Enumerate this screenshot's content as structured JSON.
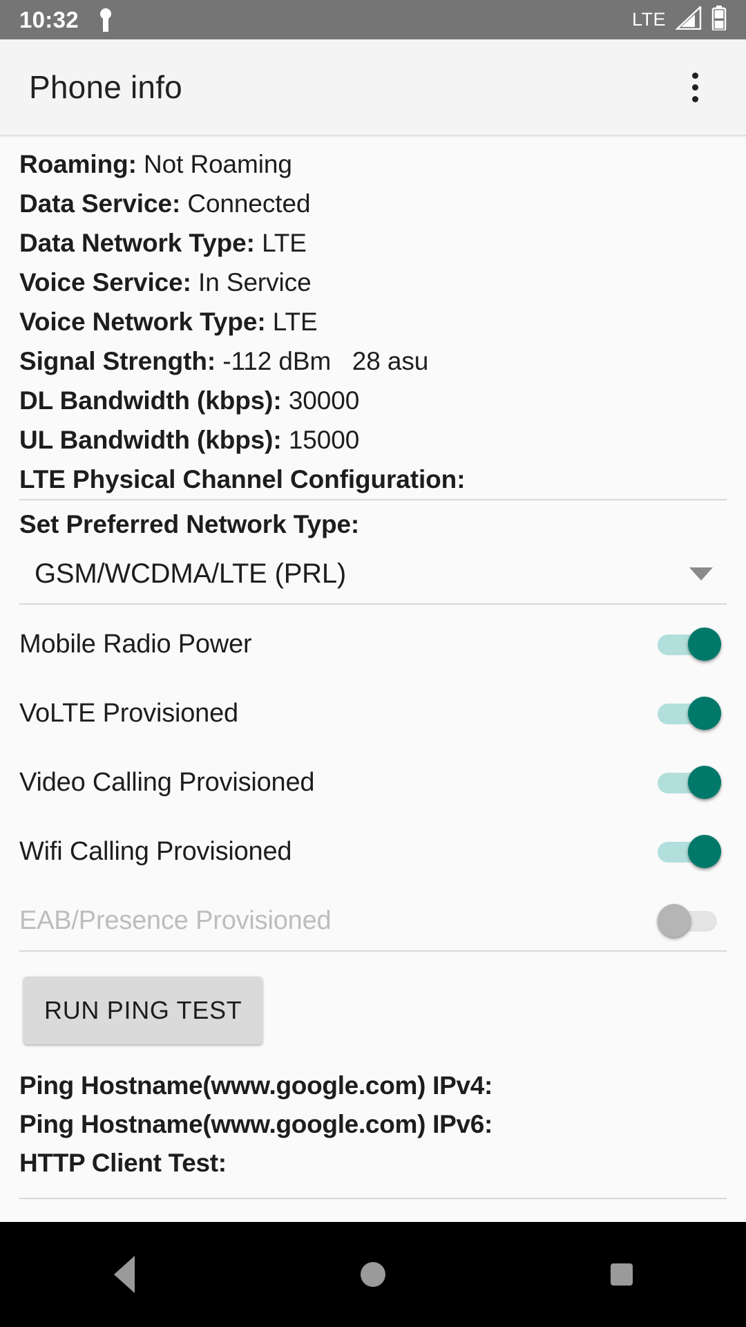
{
  "statusbar": {
    "clock": "10:32",
    "vpn_icon": "vpn-key-icon",
    "network_label": "LTE",
    "signal_icon": "signal-cellular-icon",
    "battery_icon": "battery-icon"
  },
  "appbar": {
    "title": "Phone info",
    "overflow_icon": "overflow-menu-icon"
  },
  "info": [
    {
      "key": "Roaming:",
      "value": "Not Roaming"
    },
    {
      "key": "Data Service:",
      "value": "Connected"
    },
    {
      "key": "Data Network Type:",
      "value": "LTE"
    },
    {
      "key": "Voice Service:",
      "value": "In Service"
    },
    {
      "key": "Voice Network Type:",
      "value": "LTE"
    },
    {
      "key": "Signal Strength:",
      "value": "-112 dBm   28 asu"
    },
    {
      "key": "DL Bandwidth (kbps):",
      "value": "30000"
    },
    {
      "key": "UL Bandwidth (kbps):",
      "value": "15000"
    },
    {
      "key": "LTE Physical Channel Configuration:",
      "value": ""
    }
  ],
  "preferred_network": {
    "label": "Set Preferred Network Type:",
    "selected": "GSM/WCDMA/LTE (PRL)",
    "caret_icon": "chevron-down-icon"
  },
  "switches": [
    {
      "label": "Mobile Radio Power",
      "on": true,
      "enabled": true
    },
    {
      "label": "VoLTE Provisioned",
      "on": true,
      "enabled": true
    },
    {
      "label": "Video Calling Provisioned",
      "on": true,
      "enabled": true
    },
    {
      "label": "Wifi Calling Provisioned",
      "on": true,
      "enabled": true
    },
    {
      "label": "EAB/Presence Provisioned",
      "on": false,
      "enabled": false
    }
  ],
  "ping": {
    "button_label": "RUN PING TEST",
    "results": [
      "Ping Hostname(www.google.com) IPv4:",
      "Ping Hostname(www.google.com) IPv6:",
      "HTTP Client Test:"
    ]
  },
  "navbar": {
    "back_icon": "back-triangle-icon",
    "home_icon": "home-circle-icon",
    "recents_icon": "recents-square-icon"
  },
  "colors": {
    "statusbar_bg": "#757575",
    "appbar_bg": "#f4f4f4",
    "page_bg": "#fafafa",
    "switch_on_thumb": "#00796b",
    "switch_on_track": "#b2dfdb",
    "switch_off_thumb": "#b5b5b5",
    "switch_off_track": "#e4e4e4",
    "button_bg": "#dadada",
    "navbar_bg": "#000000",
    "divider": "#d8d8d8"
  }
}
